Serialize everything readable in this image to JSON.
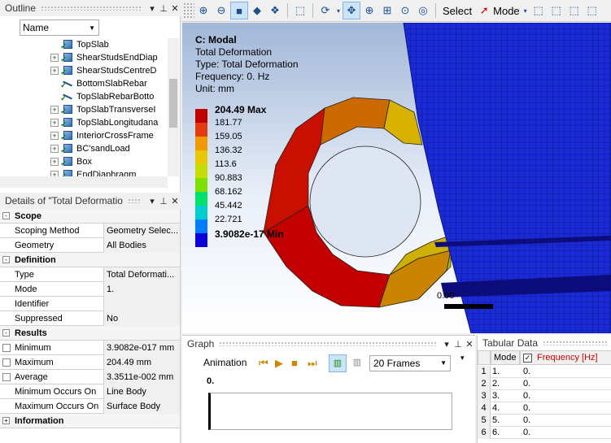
{
  "outline": {
    "title": "Outline",
    "name_dropdown": "Name",
    "items": [
      {
        "label": "TopSlab",
        "icon": "body-cube",
        "expander": ""
      },
      {
        "label": "ShearStudsEndDiap",
        "icon": "body-cube",
        "expander": "+"
      },
      {
        "label": "ShearStudsCentreD",
        "icon": "body-cube",
        "expander": "+"
      },
      {
        "label": "BottomSlabRebar",
        "icon": "rebar-line",
        "expander": ""
      },
      {
        "label": "TopSlabRebarBotto",
        "icon": "rebar-line",
        "expander": ""
      },
      {
        "label": "TopSlabTransverseI",
        "icon": "body-cube",
        "expander": "+"
      },
      {
        "label": "TopSlabLongitudana",
        "icon": "body-cube",
        "expander": "+"
      },
      {
        "label": "InteriorCrossFrame",
        "icon": "body-cube",
        "expander": "+"
      },
      {
        "label": "BC'sandLoad",
        "icon": "body-cube",
        "expander": "+"
      },
      {
        "label": "Box",
        "icon": "body-cube",
        "expander": "+"
      },
      {
        "label": "EndDiaphragm",
        "icon": "body-cube",
        "expander": "+"
      }
    ]
  },
  "details": {
    "title": "Details of \"Total Deformatio",
    "rows": [
      {
        "type": "section",
        "label": "Scope",
        "expander": "-"
      },
      {
        "type": "prop",
        "label": "Scoping Method",
        "value": "Geometry Selec..."
      },
      {
        "type": "prop",
        "label": "Geometry",
        "value": "All Bodies"
      },
      {
        "type": "section",
        "label": "Definition",
        "expander": "-"
      },
      {
        "type": "prop",
        "label": "Type",
        "value": "Total Deformati..."
      },
      {
        "type": "prop",
        "label": "Mode",
        "value": "1."
      },
      {
        "type": "prop",
        "label": "Identifier",
        "value": ""
      },
      {
        "type": "prop",
        "label": "Suppressed",
        "value": "No"
      },
      {
        "type": "section",
        "label": "Results",
        "expander": "-"
      },
      {
        "type": "check",
        "label": "Minimum",
        "value": "3.9082e-017 mm"
      },
      {
        "type": "check",
        "label": "Maximum",
        "value": "204.49 mm"
      },
      {
        "type": "check",
        "label": "Average",
        "value": "3.3511e-002 mm"
      },
      {
        "type": "prop",
        "label": "Minimum Occurs On",
        "value": "Line Body"
      },
      {
        "type": "prop",
        "label": "Maximum Occurs On",
        "value": "Surface Body"
      },
      {
        "type": "section",
        "label": "Information",
        "expander": "+"
      }
    ]
  },
  "toolbar": {
    "select_label": "Select",
    "mode_label": "Mode"
  },
  "viewport": {
    "title": "C: Modal",
    "lines": [
      "Total Deformation",
      "Type: Total Deformation",
      "Frequency: 0. Hz",
      "Unit: mm"
    ],
    "scale_label": "0.00",
    "legend": [
      {
        "label": "204.49 Max",
        "color": "#c00000",
        "bold": true
      },
      {
        "label": "181.77",
        "color": "#e33b10"
      },
      {
        "label": "159.05",
        "color": "#ee9a00"
      },
      {
        "label": "136.32",
        "color": "#e8c800"
      },
      {
        "label": "113.6",
        "color": "#c7dc00"
      },
      {
        "label": "90.883",
        "color": "#7fe000"
      },
      {
        "label": "68.162",
        "color": "#00e06a"
      },
      {
        "label": "45.442",
        "color": "#00cdd0"
      },
      {
        "label": "22.721",
        "color": "#007cff"
      },
      {
        "label": "3.9082e-17 Min",
        "color": "#0a00d8",
        "bold": true
      }
    ]
  },
  "graph": {
    "title": "Graph",
    "animation_label": "Animation",
    "frames": "20 Frames",
    "value": "0."
  },
  "tabular": {
    "title": "Tabular Data",
    "col_mode": "Mode",
    "col_freq": "Frequency [Hz]",
    "rows": [
      {
        "n": "1",
        "mode": "1.",
        "freq": "0."
      },
      {
        "n": "2",
        "mode": "2.",
        "freq": "0."
      },
      {
        "n": "3",
        "mode": "3.",
        "freq": "0."
      },
      {
        "n": "4",
        "mode": "4.",
        "freq": "0."
      },
      {
        "n": "5",
        "mode": "5.",
        "freq": "0."
      },
      {
        "n": "6",
        "mode": "6.",
        "freq": "0."
      }
    ]
  }
}
